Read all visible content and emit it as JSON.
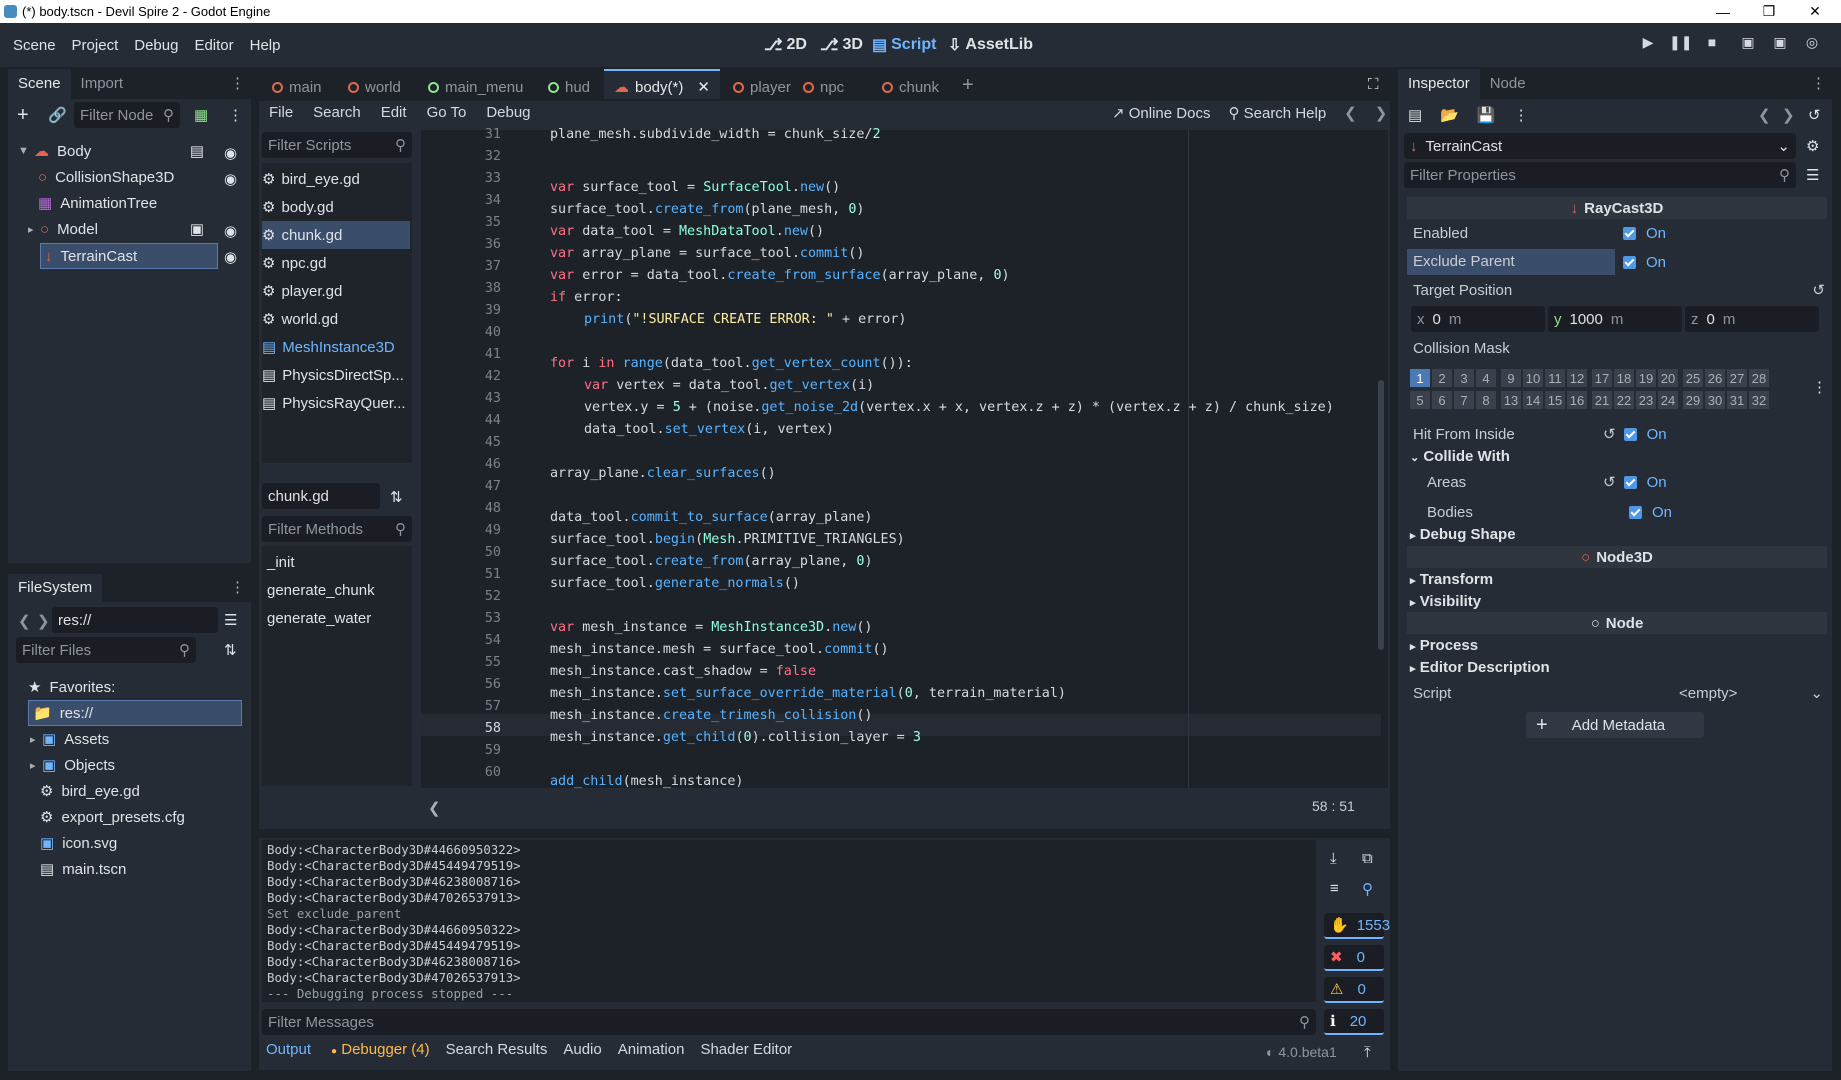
{
  "window": {
    "title": "(*) body.tscn - Devil Spire 2 - Godot Engine"
  },
  "menu": [
    "Scene",
    "Project",
    "Debug",
    "Editor",
    "Help"
  ],
  "workspaces": [
    {
      "label": "2D"
    },
    {
      "label": "3D"
    },
    {
      "label": "Script"
    },
    {
      "label": "AssetLib"
    }
  ],
  "scene_dock": {
    "tabs": [
      "Scene",
      "Import"
    ],
    "filter_placeholder": "Filter Node",
    "nodes": [
      "Body",
      "CollisionShape3D",
      "AnimationTree",
      "Model",
      "TerrainCast"
    ]
  },
  "filesystem": {
    "tab": "FileSystem",
    "path": "res://",
    "filter_placeholder": "Filter Files",
    "items": [
      "Favorites:",
      "res://",
      "Assets",
      "Objects",
      "bird_eye.gd",
      "export_presets.cfg",
      "icon.svg",
      "main.tscn"
    ]
  },
  "editor_tabs": [
    "main",
    "world",
    "main_menu",
    "hud",
    "body(*)",
    "player",
    "npc",
    "chunk"
  ],
  "script_menu": [
    "File",
    "Search",
    "Edit",
    "Go To",
    "Debug"
  ],
  "script_toolbar": {
    "online_docs": "Online Docs",
    "search_help": "Search Help"
  },
  "scripts": {
    "filter_placeholder": "Filter Scripts",
    "items": [
      "bird_eye.gd",
      "body.gd",
      "chunk.gd",
      "npc.gd",
      "player.gd",
      "world.gd",
      "MeshInstance3D",
      "PhysicsDirectSp...",
      "PhysicsRayQuer..."
    ],
    "current": "chunk.gd",
    "methods_placeholder": "Filter Methods",
    "methods": [
      "_init",
      "generate_chunk",
      "generate_water"
    ]
  },
  "code": {
    "line_numbers": [
      "31",
      "32",
      "33",
      "34",
      "35",
      "36",
      "37",
      "38",
      "39",
      "40",
      "41",
      "42",
      "43",
      "44",
      "45",
      "46",
      "47",
      "48",
      "49",
      "50",
      "51",
      "52",
      "53",
      "54",
      "55",
      "56",
      "57",
      "58",
      "59",
      "60"
    ],
    "cursor": "58 :   51"
  },
  "output": {
    "lines": [
      "Body:<CharacterBody3D#44660950322>",
      "Body:<CharacterBody3D#45449479519>",
      "Body:<CharacterBody3D#46238008716>",
      "Body:<CharacterBody3D#47026537913>",
      "Set exclude_parent",
      "Body:<CharacterBody3D#44660950322>",
      "Body:<CharacterBody3D#45449479519>",
      "Body:<CharacterBody3D#46238008716>",
      "Body:<CharacterBody3D#47026537913>",
      "--- Debugging process stopped ---"
    ],
    "filter_placeholder": "Filter Messages",
    "counts": {
      "messages": "1553",
      "errors": "0",
      "warnings": "0",
      "info": "20"
    }
  },
  "bottom_tabs": [
    "Output",
    "Debugger (4)",
    "Search Results",
    "Audio",
    "Animation",
    "Shader Editor"
  ],
  "version": "4.0.beta1",
  "inspector": {
    "tabs": [
      "Inspector",
      "Node"
    ],
    "node": "TerrainCast",
    "filter_placeholder": "Filter Properties",
    "class": "RayCast3D",
    "enabled": "Enabled",
    "exclude_parent": "Exclude Parent",
    "on": "On",
    "target_position": "Target Position",
    "tp": {
      "x": "0",
      "y": "1000",
      "z": "0",
      "unit": "m"
    },
    "collision_mask": "Collision Mask",
    "bits_top": [
      "1",
      "2",
      "3",
      "4",
      "9",
      "10",
      "11",
      "12",
      "17",
      "18",
      "19",
      "20",
      "25",
      "26",
      "27",
      "28"
    ],
    "bits_bottom": [
      "5",
      "6",
      "7",
      "8",
      "13",
      "14",
      "15",
      "16",
      "21",
      "22",
      "23",
      "24",
      "29",
      "30",
      "31",
      "32"
    ],
    "hit_from_inside": "Hit From Inside",
    "collide_with": "Collide With",
    "areas": "Areas",
    "bodies": "Bodies",
    "debug_shape": "Debug Shape",
    "node3d": "Node3D",
    "transform": "Transform",
    "visibility": "Visibility",
    "node_sect": "Node",
    "process": "Process",
    "editor_description": "Editor Description",
    "script": "Script",
    "script_val": "<empty>",
    "add_metadata": "Add Metadata"
  }
}
